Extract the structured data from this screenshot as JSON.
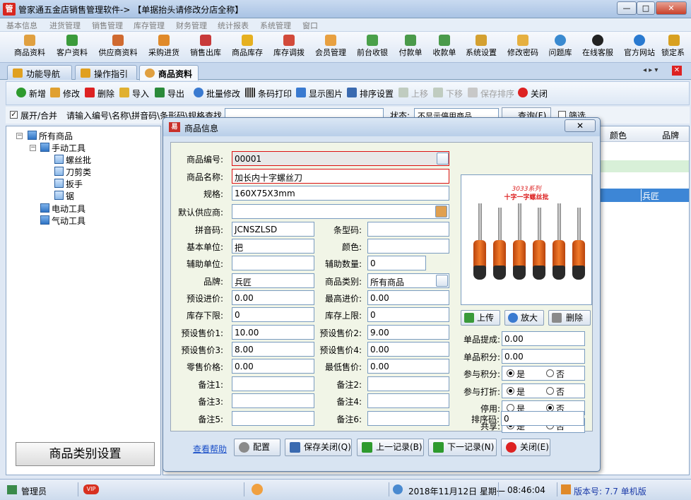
{
  "window": {
    "app_icon": "管",
    "title": "管家通五金店销售管理软件-> 【单据抬头请修改分店全称】",
    "min": "—",
    "max": "□",
    "close": "✕"
  },
  "menu": [
    "基本信息",
    "进货管理",
    "销售管理",
    "库存管理",
    "财务管理",
    "统计报表",
    "系统管理",
    "窗口"
  ],
  "toolbar": [
    {
      "label": "商品资料",
      "icon": "goods-icon",
      "color": "#e0a040"
    },
    {
      "label": "客户资料",
      "icon": "customer-icon",
      "color": "#3b9b3b"
    },
    {
      "label": "供应商资料",
      "icon": "supplier-icon",
      "color": "#d06a30"
    },
    {
      "label": "采购进货",
      "icon": "purchase-icon",
      "color": "#e08a2a"
    },
    {
      "label": "销售出库",
      "icon": "sales-icon",
      "color": "#c83a3a"
    },
    {
      "label": "商品库存",
      "icon": "stock-icon",
      "color": "#e6b020"
    },
    {
      "label": "库存调拨",
      "icon": "transfer-icon",
      "color": "#d24a3a"
    },
    {
      "label": "会员管理",
      "icon": "member-icon",
      "color": "#e8a040"
    },
    {
      "label": "前台收银",
      "icon": "cashier-icon",
      "color": "#4aa04a"
    },
    {
      "label": "付款单",
      "icon": "payment-icon",
      "color": "#4a9a4a"
    },
    {
      "label": "收款单",
      "icon": "receipt-icon",
      "color": "#4a9a4a"
    },
    {
      "label": "系统设置",
      "icon": "settings-icon",
      "color": "#d4a030"
    },
    {
      "label": "修改密码",
      "icon": "password-icon",
      "color": "#e6b040"
    },
    {
      "label": "问题库",
      "icon": "question-icon",
      "color": "#3a8ad0"
    },
    {
      "label": "在线客服",
      "icon": "qq-icon",
      "color": "#222"
    },
    {
      "label": "官方网站",
      "icon": "ie-icon",
      "color": "#2a7ad0"
    },
    {
      "label": "锁定系",
      "icon": "lock-icon",
      "color": "#d8a020"
    }
  ],
  "tabs": [
    {
      "label": "功能导航",
      "icon": "nav-icon"
    },
    {
      "label": "操作指引",
      "icon": "guide-icon"
    },
    {
      "label": "商品资料",
      "icon": "goods-icon"
    }
  ],
  "tab_controls": {
    "nav": "◂ ▸ ▾",
    "close": "✕"
  },
  "actions": [
    {
      "label": "新增",
      "icon": "add-icon",
      "color": "#2e9a2e",
      "enabled": true
    },
    {
      "label": "修改",
      "icon": "edit-icon",
      "color": "#e0a030",
      "enabled": true
    },
    {
      "label": "删除",
      "icon": "delete-icon",
      "color": "#d22",
      "enabled": true
    },
    {
      "label": "导入",
      "icon": "import-icon",
      "color": "#e0b030",
      "enabled": true
    },
    {
      "label": "导出",
      "icon": "export-icon",
      "color": "#2a8a3a",
      "enabled": true
    },
    {
      "label": "批量修改",
      "icon": "batch-edit-icon",
      "color": "#3a7ad0",
      "enabled": true
    },
    {
      "label": "条码打印",
      "icon": "barcode-icon",
      "color": "#444",
      "enabled": true
    },
    {
      "label": "显示图片",
      "icon": "image-icon",
      "color": "#3a7ad0",
      "enabled": true
    },
    {
      "label": "排序设置",
      "icon": "sort-icon",
      "color": "#3a6ab0",
      "enabled": true
    },
    {
      "label": "上移",
      "icon": "up-icon",
      "color": "#a0b0a0",
      "enabled": false
    },
    {
      "label": "下移",
      "icon": "down-icon",
      "color": "#a0b0a0",
      "enabled": false
    },
    {
      "label": "保存排序",
      "icon": "save-sort-icon",
      "color": "#a0a0a0",
      "enabled": false
    },
    {
      "label": "关闭",
      "icon": "close-icon",
      "color": "#d22",
      "enabled": true
    }
  ],
  "filter": {
    "expand_label": "展开/合并",
    "search_label": "请输入编号\\名称\\拼音码\\条形码\\规格查找：",
    "status_label": "状态:",
    "status_value": "不显示停用商品",
    "query_label": "查询(F)",
    "filter_label": "筛选"
  },
  "tree": {
    "root": "所有商品",
    "groups": [
      {
        "label": "手动工具",
        "children": [
          "螺丝批",
          "刀剪类",
          "扳手",
          "锯"
        ]
      },
      {
        "label": "电动工具",
        "children": []
      },
      {
        "label": "气动工具",
        "children": []
      }
    ],
    "category_button": "商品类别设置"
  },
  "grid": {
    "columns": [
      "颜色",
      "品牌"
    ],
    "selected_brand": "兵匠"
  },
  "dialog": {
    "title": "商品信息",
    "close": "✕",
    "fields": {
      "code": {
        "label": "商品编号:",
        "value": "00001"
      },
      "name": {
        "label": "商品名称:",
        "value": "加长内十字螺丝刀"
      },
      "spec": {
        "label": "规格:",
        "value": "160X75X3mm"
      },
      "supplier": {
        "label": "默认供应商:",
        "value": ""
      },
      "pinyin": {
        "label": "拼音码:",
        "value": "JCNSZLSD"
      },
      "barcode": {
        "label": "条型码:",
        "value": ""
      },
      "unit": {
        "label": "基本单位:",
        "value": "把"
      },
      "color": {
        "label": "颜色:",
        "value": ""
      },
      "aux_unit": {
        "label": "辅助单位:",
        "value": ""
      },
      "aux_qty": {
        "label": "辅助数量:",
        "value": "0"
      },
      "brand": {
        "label": "品牌:",
        "value": "兵匠"
      },
      "category": {
        "label": "商品类别:",
        "value": "所有商品"
      },
      "cost": {
        "label": "预设进价:",
        "value": "0.00"
      },
      "max_cost": {
        "label": "最高进价:",
        "value": "0.00"
      },
      "min_stock": {
        "label": "库存下限:",
        "value": "0"
      },
      "max_stock": {
        "label": "库存上限:",
        "value": "0"
      },
      "price1": {
        "label": "预设售价1:",
        "value": "10.00"
      },
      "price2": {
        "label": "预设售价2:",
        "value": "9.00"
      },
      "price3": {
        "label": "预设售价3:",
        "value": "8.00"
      },
      "price4": {
        "label": "预设售价4:",
        "value": "0.00"
      },
      "retail": {
        "label": "零售价格:",
        "value": "0.00"
      },
      "min_price": {
        "label": "最低售价:",
        "value": "0.00"
      },
      "note1": {
        "label": "备注1:",
        "value": ""
      },
      "note2": {
        "label": "备注2:",
        "value": ""
      },
      "note3": {
        "label": "备注3:",
        "value": ""
      },
      "note4": {
        "label": "备注4:",
        "value": ""
      },
      "note5": {
        "label": "备注5:",
        "value": ""
      },
      "note6": {
        "label": "备注6:",
        "value": ""
      },
      "commission": {
        "label": "单品提成:",
        "value": "0.00"
      },
      "points": {
        "label": "单品积分:",
        "value": "0.00"
      },
      "sort": {
        "label": "排序码:",
        "value": "0"
      }
    },
    "options": {
      "join_points": {
        "label": "参与积分:",
        "yes": "是",
        "no": "否",
        "value": "是"
      },
      "join_discount": {
        "label": "参与打折:",
        "yes": "是",
        "no": "否",
        "value": "是"
      },
      "disabled": {
        "label": "停用:",
        "yes": "是",
        "no": "否",
        "value": "否"
      },
      "shared": {
        "label": "共享:",
        "yes": "是",
        "no": "否",
        "value": "是"
      }
    },
    "image": {
      "caption1": "3033系列",
      "caption2": "十字一字螺丝批",
      "upload": "上传",
      "zoom": "放大",
      "delete": "删除"
    },
    "buttons": {
      "help": "查看帮助",
      "config": "配置",
      "save_close": "保存关闭(Q)",
      "prev": "上一记录(B)",
      "next": "下一记录(N)",
      "close": "关闭(E)"
    }
  },
  "status": {
    "user": "管理员",
    "vip": "VIP",
    "date": "2018年11月12日 星期一",
    "time": "08:46:04",
    "version": "版本号: 7.7 单机版"
  }
}
